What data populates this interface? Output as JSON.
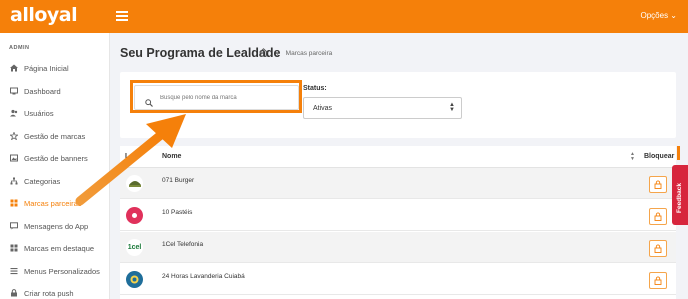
{
  "brand": {
    "logo": "alloyal",
    "accent": "#f5800a"
  },
  "topbar": {
    "options_label": "Opções ⌄"
  },
  "sidebar": {
    "section": "ADMIN",
    "items": [
      {
        "label": "Página Inicial",
        "icon": "home-icon"
      },
      {
        "label": "Dashboard",
        "icon": "monitor-icon"
      },
      {
        "label": "Usuários",
        "icon": "users-icon"
      },
      {
        "label": "Gestão de marcas",
        "icon": "star-icon"
      },
      {
        "label": "Gestão de banners",
        "icon": "image-icon"
      },
      {
        "label": "Categorias",
        "icon": "sitemap-icon"
      },
      {
        "label": "Marcas parceiras",
        "icon": "grid-icon",
        "active": true
      },
      {
        "label": "Mensagens do App",
        "icon": "message-icon"
      },
      {
        "label": "Marcas em destaque",
        "icon": "grid-icon"
      },
      {
        "label": "Menus Personalizados",
        "icon": "list-icon"
      },
      {
        "label": "Criar rota push",
        "icon": "lock-icon"
      }
    ]
  },
  "page": {
    "title": "Seu Programa de Lealdade",
    "breadcrumb_current": "Marcas parceira"
  },
  "filters": {
    "search_placeholder": "Busque pelo nome da marca",
    "status_label": "Status:",
    "status_value": "Ativas"
  },
  "table": {
    "columns": {
      "logo": "L",
      "name": "Nome",
      "block": "Bloquear"
    },
    "rows": [
      {
        "name": "071 Burger",
        "logo_color": "#5a6b2e",
        "logo_text": ""
      },
      {
        "name": "10 Pastéis",
        "logo_color": "#e0315b",
        "logo_text": ""
      },
      {
        "name": "1Cel Telefonia",
        "logo_color": "#ffffff",
        "logo_text": "1cel"
      },
      {
        "name": "24 Horas Lavanderia Cuiabá",
        "logo_color": "#1f6e9a",
        "logo_text": ""
      }
    ]
  },
  "feedback_label": "Feedback"
}
